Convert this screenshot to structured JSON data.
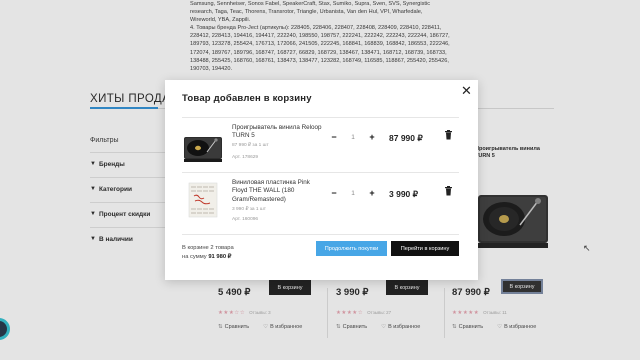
{
  "background": {
    "text_lines": [
      "Samsung, Sennheiser, Sonos Fabel, SpeakerCraft, Stax, Sumiko, Supra, Sven, SVS, Synergistic",
      "research, Taga, Teac, Thorens, Transrotor, Triangle, Urbanista, Van den Hul, VPI, Wharfedale,",
      "Wireworld, YBA, Zappili.",
      "4. Товары бренда Pro-Ject (артикулы): 228405, 228406, 228407, 228408, 228409, 228410, 228411,",
      "228412, 228413, 194416, 194417, 222240, 198550, 198757, 222241, 222242, 222243, 222244, 186727,",
      "189793, 123278, 255424, 176713, 172066, 241505, 222245, 168841, 168839, 168842, 186553, 222246,",
      "172074, 189767, 189796, 168747, 168727, 66829, 168729, 138467, 138471, 168712, 168739, 168733,",
      "138488, 255425, 168760, 168761, 138473, 138477, 123282, 168749, 116585, 118867, 255420, 255426,",
      "190703, 194420."
    ],
    "section_title": "ХИТЫ ПРОДАЖ",
    "filters": {
      "title": "Фильтры",
      "items": [
        "Бренды",
        "Категории",
        "Процент скидки",
        "В наличии"
      ]
    },
    "products": [
      {
        "price": "5 490 ₽",
        "button": "В корзину",
        "reviews": "Отзывы: 3",
        "compare": "Сравнить",
        "favorite": "В избранное"
      },
      {
        "price": "3 990 ₽",
        "button": "В корзину",
        "reviews": "Отзывы: 27",
        "compare": "Сравнить",
        "favorite": "В избранное"
      },
      {
        "price": "87 990 ₽",
        "button": "В корзину",
        "reviews": "Отзывы: 11",
        "compare": "Сравнить",
        "favorite": "В избранное"
      }
    ],
    "right_card_title_1": "Проигрыватель винила",
    "right_card_title_2": "TURN 5"
  },
  "modal": {
    "title": "Товар добавлен в корзину",
    "items": [
      {
        "name": "Проигрыватель винила Reloop TURN 5",
        "unit_price": "87 990 ₽ за 1 шт",
        "sku": "Арт. 178629",
        "quantity": "1",
        "total": "87 990 ₽"
      },
      {
        "name": "Виниловая пластинка Pink Floyd THE WALL (180 Gram/Remastered)",
        "unit_price": "3 990 ₽ за 1 шт",
        "sku": "Арт. 160096",
        "quantity": "1",
        "total": "3 990 ₽"
      }
    ],
    "summary_count": "В корзине 2 товара",
    "summary_sum_prefix": "на сумму",
    "summary_sum": "91 980 ₽",
    "continue_button": "Продолжить покупки",
    "cart_button": "Перейти в корзину"
  },
  "colors": {
    "accent_blue": "#47a6e6",
    "dark_button": "#111111",
    "star_pink": "#e8a0ad"
  }
}
